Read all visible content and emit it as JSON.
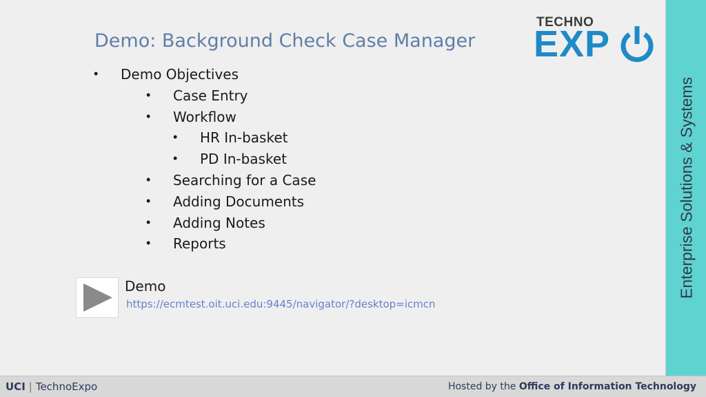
{
  "slide": {
    "title": "Demo: Background Check Case Manager",
    "bullets": [
      {
        "text": "Demo Objectives",
        "level": 1
      },
      {
        "text": "Case Entry",
        "level": 2
      },
      {
        "text": "Workflow",
        "level": 2
      },
      {
        "text": "HR In-basket",
        "level": 3
      },
      {
        "text": "PD In-basket",
        "level": 3
      },
      {
        "text": "Searching for a Case",
        "level": 2
      },
      {
        "text": "Adding Documents",
        "level": 2
      },
      {
        "text": "Adding Notes",
        "level": 2
      },
      {
        "text": "Reports",
        "level": 2
      }
    ],
    "bullet_glyph": "•",
    "demo": {
      "label": "Demo",
      "link": "https://ecmtest.oit.uci.edu:9445/navigator/?desktop=icmcn",
      "icon": "play-icon"
    }
  },
  "logo": {
    "top": "TECHNO",
    "main": "EXP",
    "icon": "power-icon",
    "color": "#1f8ac8"
  },
  "side_band": {
    "text": "Enterprise Solutions & Systems",
    "color": "#5fd3cf"
  },
  "footer": {
    "left_brand": "UCI",
    "left_sep": "|",
    "left_text": "TechnoExpo",
    "right_prefix": "Hosted by the",
    "right_bold": "Office of Information Technology"
  }
}
